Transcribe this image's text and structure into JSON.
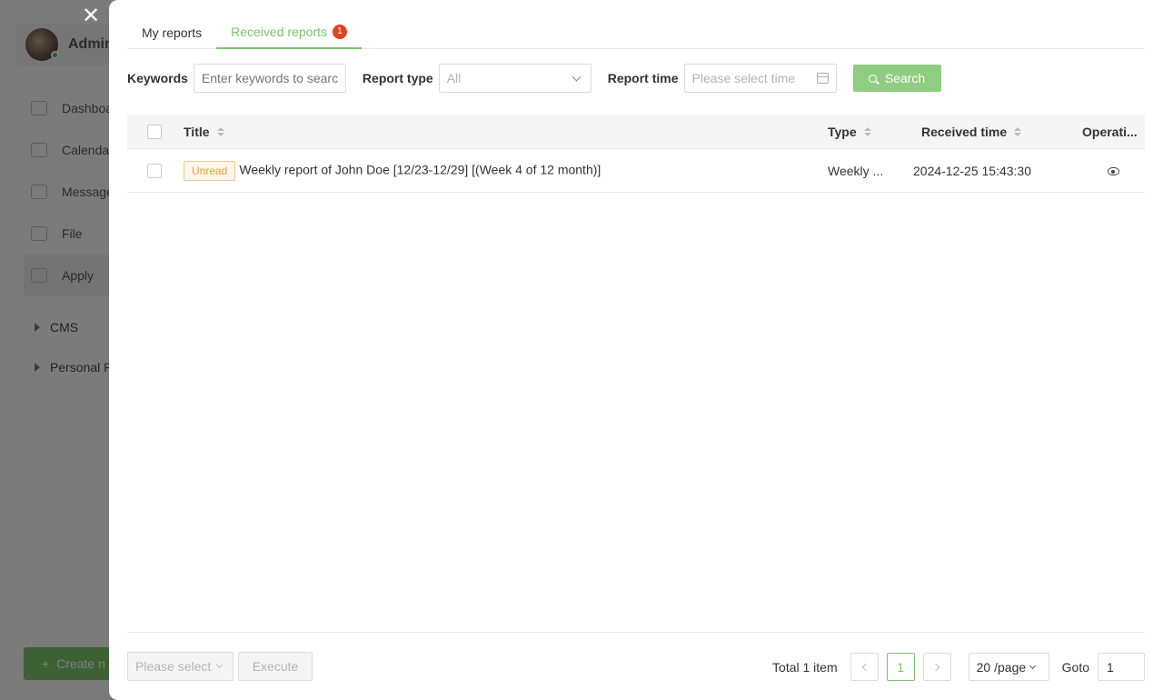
{
  "background": {
    "user_name": "Admin",
    "nav_items": [
      {
        "label": "Dashboard",
        "icon": "dashboard-icon"
      },
      {
        "label": "Calendar",
        "icon": "calendar-icon"
      },
      {
        "label": "Message",
        "icon": "message-icon"
      },
      {
        "label": "File",
        "icon": "file-icon"
      },
      {
        "label": "Apply",
        "icon": "apply-icon"
      }
    ],
    "groups": [
      {
        "label": "CMS"
      },
      {
        "label": "Personal R"
      }
    ],
    "create_label": "Create n"
  },
  "close_icon": "close-icon",
  "tabs": [
    {
      "label": "My reports",
      "active": false
    },
    {
      "label": "Received reports",
      "active": true,
      "badge": "1"
    }
  ],
  "filters": {
    "keywords_label": "Keywords",
    "keywords_placeholder": "Enter keywords to search",
    "type_label": "Report type",
    "type_value": "All",
    "time_label": "Report time",
    "time_placeholder": "Please select time",
    "search_label": "Search"
  },
  "table": {
    "columns": {
      "title": "Title",
      "type": "Type",
      "received_time": "Received time",
      "operation": "Operati..."
    },
    "rows": [
      {
        "status": "Unread",
        "title": "Weekly report of John Doe [12/23-12/29] [(Week 4 of 12 month)]",
        "type": "Weekly ...",
        "received_time": "2024-12-25 15:43:30",
        "operation_icon": "eye-icon"
      }
    ]
  },
  "footer": {
    "bulk_placeholder": "Please select",
    "execute_label": "Execute",
    "total": "Total 1 item",
    "current_page": "1",
    "page_size": "20 /page",
    "goto_label": "Goto",
    "goto_value": "1"
  },
  "colors": {
    "accent": "#7cc36a",
    "badge": "#e1431f",
    "unread_text": "#e6a23c"
  }
}
